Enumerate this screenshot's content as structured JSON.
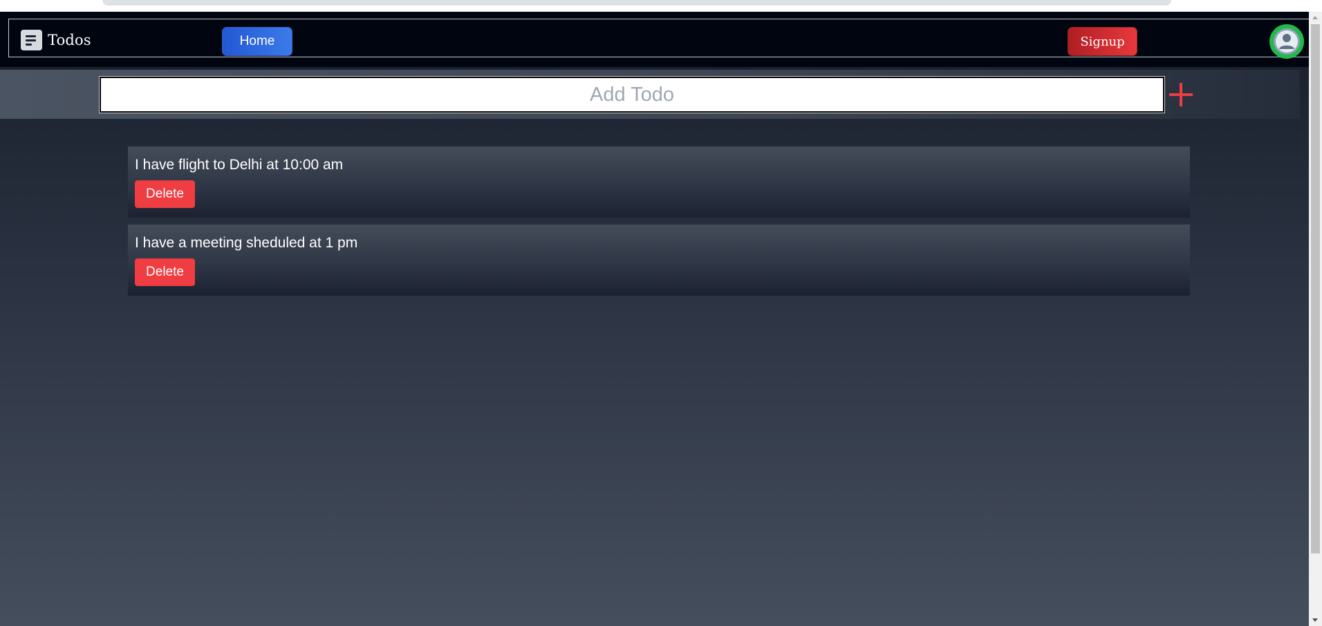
{
  "navbar": {
    "brand_icon": "notes-icon",
    "brand_label": "Todos",
    "home_label": "Home",
    "signup_label": "Signup",
    "avatar_icon": "user-icon",
    "home_color": "#2f6be0",
    "signup_color": "#d92c30",
    "avatar_color": "#22b84a"
  },
  "add_todo": {
    "placeholder": "Add Todo",
    "value": "",
    "add_icon": "plus-icon",
    "add_color": "#ef3d42"
  },
  "todos": [
    {
      "text": "I have flight to Delhi at 10:00 am",
      "delete_label": "Delete"
    },
    {
      "text": "I have a meeting sheduled at 1 pm",
      "delete_label": "Delete"
    }
  ]
}
